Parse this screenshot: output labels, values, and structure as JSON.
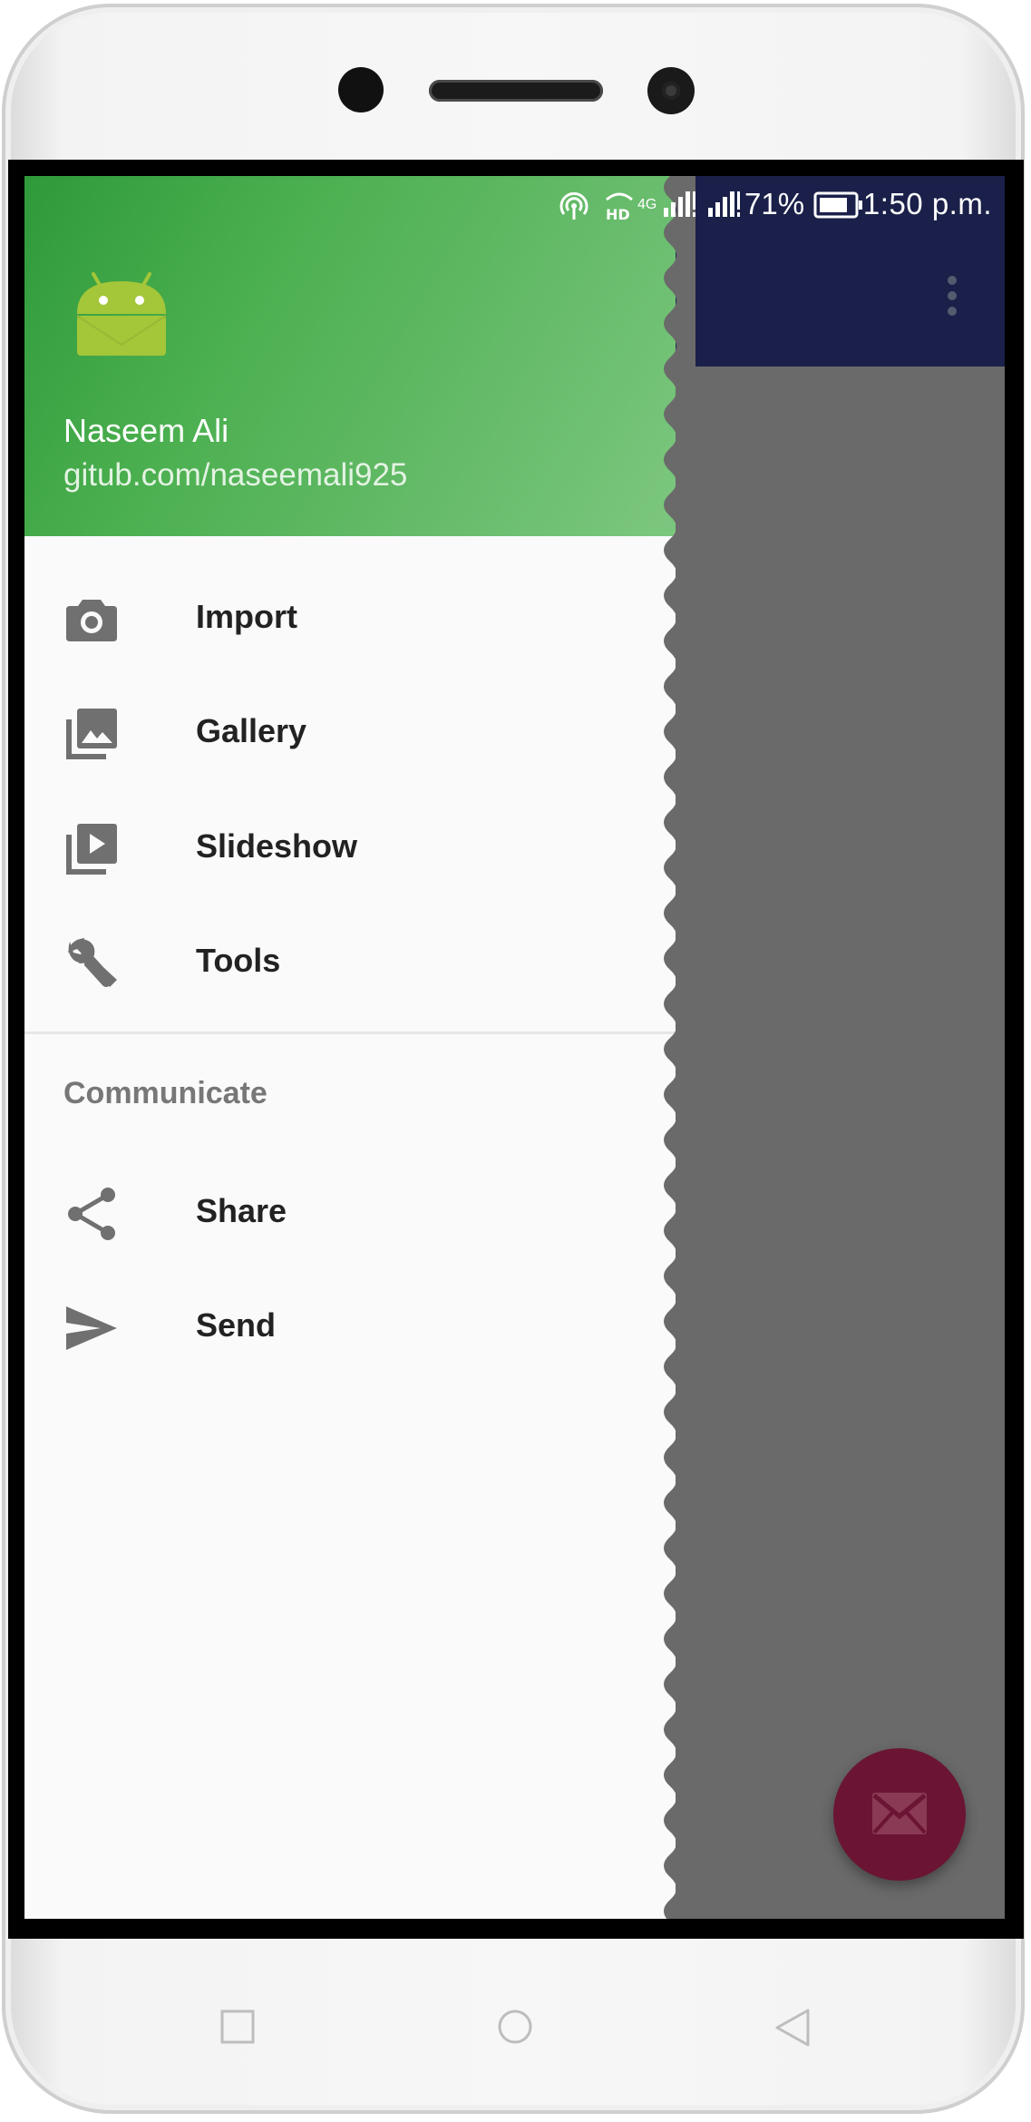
{
  "status_bar": {
    "battery_percent": "71%",
    "time": "1:50 p.m.",
    "network_label": "4G",
    "icons": [
      "hotspot-icon",
      "hd-voice-icon",
      "signal-icon",
      "signal-icon",
      "battery-icon"
    ]
  },
  "drawer": {
    "header": {
      "user_name": "Naseem Ali",
      "user_link": "gitub.com/naseemali925",
      "logo_icon": "android-icon",
      "gradient_colors": [
        "#2f9a3a",
        "#7cc77f"
      ]
    },
    "items": [
      {
        "label": "Import",
        "icon": "camera-icon"
      },
      {
        "label": "Gallery",
        "icon": "gallery-icon"
      },
      {
        "label": "Slideshow",
        "icon": "slideshow-icon"
      },
      {
        "label": "Tools",
        "icon": "wrench-icon"
      }
    ],
    "section_title": "Communicate",
    "section_items": [
      {
        "label": "Share",
        "icon": "share-icon"
      },
      {
        "label": "Send",
        "icon": "send-icon"
      }
    ]
  },
  "app_bar": {
    "overflow_icon": "more-vert-icon",
    "color": "#1a2049"
  },
  "fab": {
    "icon": "mail-icon",
    "color": "#6b1433"
  },
  "nav_bar": {
    "buttons": [
      "recents-icon",
      "home-icon",
      "back-icon"
    ]
  }
}
